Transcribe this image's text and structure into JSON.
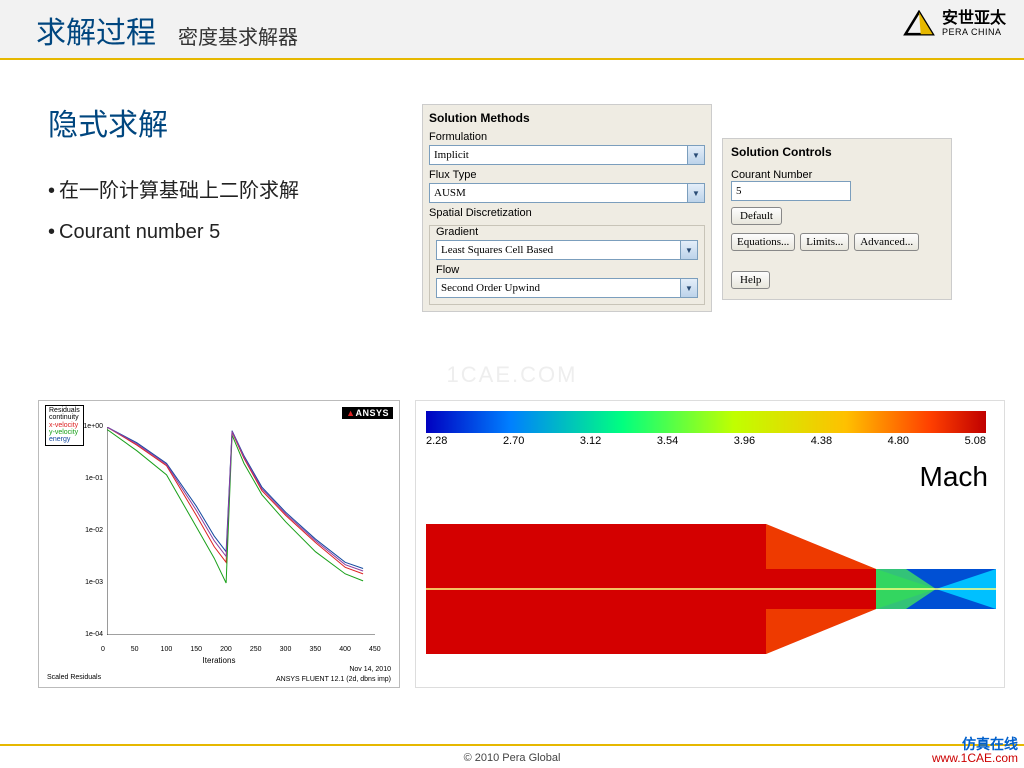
{
  "header": {
    "title": "求解过程",
    "subtitle": "密度基求解器"
  },
  "logo": {
    "name": "安世亚太",
    "sub": "PERA CHINA"
  },
  "section": {
    "title": "隐式求解"
  },
  "bullets": [
    "在一阶计算基础上二阶求解",
    "Courant number 5"
  ],
  "methods": {
    "title": "Solution Methods",
    "formulation_label": "Formulation",
    "formulation_value": "Implicit",
    "flux_label": "Flux Type",
    "flux_value": "AUSM",
    "spatial_label": "Spatial Discretization",
    "gradient_label": "Gradient",
    "gradient_value": "Least Squares Cell Based",
    "flow_label": "Flow",
    "flow_value": "Second Order Upwind"
  },
  "controls": {
    "title": "Solution Controls",
    "courant_label": "Courant Number",
    "courant_value": "5",
    "default": "Default",
    "equations": "Equations...",
    "limits": "Limits...",
    "advanced": "Advanced...",
    "help": "Help"
  },
  "chart_data": [
    {
      "type": "line",
      "title": "Scaled Residuals",
      "xlabel": "Iterations",
      "xlim": [
        0,
        450
      ],
      "ylim": [
        0.0001,
        1.0
      ],
      "yscale": "log",
      "x_ticks": [
        0,
        50,
        100,
        150,
        200,
        250,
        300,
        350,
        400,
        450
      ],
      "y_ticks": [
        "1e+00",
        "1e-01",
        "1e-02",
        "1e-03",
        "1e-04"
      ],
      "legend": [
        "Residuals",
        "continuity",
        "x-velocity",
        "y-velocity",
        "energy"
      ],
      "series": [
        {
          "name": "continuity",
          "color": "#ffffff"
        },
        {
          "name": "x-velocity",
          "color": "#d22",
          "x": [
            0,
            50,
            100,
            150,
            180,
            200,
            210,
            230,
            260,
            300,
            350,
            400,
            430
          ],
          "y": [
            1.0,
            0.45,
            0.18,
            0.02,
            0.005,
            0.0025,
            0.8,
            0.25,
            0.06,
            0.02,
            0.006,
            0.002,
            0.0015
          ]
        },
        {
          "name": "y-velocity",
          "color": "#19a019",
          "x": [
            0,
            50,
            100,
            150,
            180,
            200,
            210,
            230,
            260,
            300,
            350,
            400,
            430
          ],
          "y": [
            0.9,
            0.35,
            0.12,
            0.012,
            0.003,
            0.001,
            0.7,
            0.2,
            0.05,
            0.015,
            0.004,
            0.0015,
            0.0011
          ]
        },
        {
          "name": "energy",
          "color": "#1449a0",
          "x": [
            0,
            50,
            100,
            150,
            180,
            200,
            210,
            230,
            260,
            300,
            350,
            400,
            430
          ],
          "y": [
            1.0,
            0.5,
            0.2,
            0.03,
            0.008,
            0.004,
            0.85,
            0.28,
            0.07,
            0.023,
            0.007,
            0.0025,
            0.0019
          ]
        }
      ],
      "annotations": {
        "ansys": "ANSYS",
        "date": "Nov 14, 2010",
        "software": "ANSYS FLUENT 12.1 (2d, dbns imp)",
        "scaled": "Scaled Residuals"
      }
    },
    {
      "type": "heatmap",
      "title": "Mach",
      "colorbar_ticks": [
        "2.28",
        "2.70",
        "3.12",
        "3.54",
        "3.96",
        "4.38",
        "4.80",
        "5.08"
      ],
      "range": [
        2.28,
        5.08
      ],
      "description": "Mach contour in converging-diverging nozzle; red (≈5) in inlet/straight section, blue-to-green shock diamonds downstream of throat"
    }
  ],
  "watermark": "1CAE.COM",
  "footer": {
    "copyright": "© 2010 Pera Global",
    "brand_cn": "仿真在线",
    "brand_url": "www.1CAE.com"
  }
}
